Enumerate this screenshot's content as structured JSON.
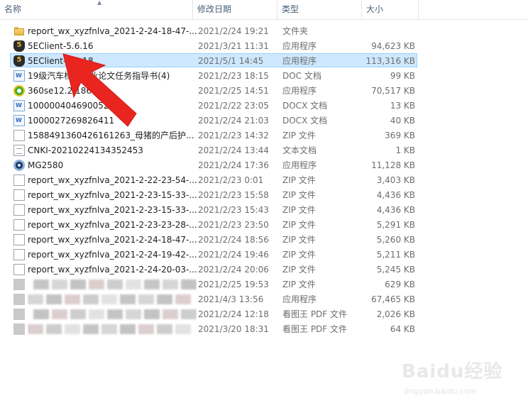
{
  "columns": {
    "name": "名称",
    "date": "修改日期",
    "type": "类型",
    "size": "大小"
  },
  "rows": [
    {
      "icon": "folder-icon",
      "name": "report_wx_xyzfnlva_2021-2-24-18-47-...",
      "date": "2021/2/24 19:21",
      "type": "文件夹",
      "size": ""
    },
    {
      "icon": "5eclient-app-icon",
      "name": "5EClient-5.6.16",
      "date": "2021/3/21 11:31",
      "type": "应用程序",
      "size": "94,623 KB"
    },
    {
      "icon": "5eclient-app-icon",
      "name": "5EClient-5.6.18",
      "date": "2021/5/1 14:45",
      "type": "应用程序",
      "size": "113,316 KB",
      "selected": true
    },
    {
      "icon": "word-doc-icon",
      "name": "19级汽车检测毕业论文任务指导书(4)",
      "date": "2021/2/23 18:15",
      "type": "DOC 文档",
      "size": "99 KB"
    },
    {
      "icon": "360-browser-icon",
      "name": "360se12.2.1860.0",
      "date": "2021/2/25 14:51",
      "type": "应用程序",
      "size": "70,517 KB"
    },
    {
      "icon": "word-doc-icon",
      "name": "1000004046900524",
      "date": "2021/2/22 23:05",
      "type": "DOCX 文档",
      "size": "13 KB"
    },
    {
      "icon": "word-doc-icon",
      "name": "1000027269826411",
      "date": "2021/2/24 21:03",
      "type": "DOCX 文档",
      "size": "40 KB"
    },
    {
      "icon": "zip-file-icon",
      "name": "1588491360426161263_母猪的产后护...",
      "date": "2021/2/23 14:32",
      "type": "ZIP 文件",
      "size": "369 KB"
    },
    {
      "icon": "text-file-icon",
      "name": "CNKI-20210224134352453",
      "date": "2021/2/24 13:44",
      "type": "文本文档",
      "size": "1 KB"
    },
    {
      "icon": "mg-app-icon",
      "name": "MG2580",
      "date": "2021/2/24 17:36",
      "type": "应用程序",
      "size": "11,128 KB"
    },
    {
      "icon": "zip-file-icon",
      "name": "report_wx_xyzfnlva_2021-2-22-23-54-...",
      "date": "2021/2/23 0:01",
      "type": "ZIP 文件",
      "size": "3,403 KB"
    },
    {
      "icon": "zip-file-icon",
      "name": "report_wx_xyzfnlva_2021-2-23-15-33-...",
      "date": "2021/2/23 15:58",
      "type": "ZIP 文件",
      "size": "4,436 KB"
    },
    {
      "icon": "zip-file-icon",
      "name": "report_wx_xyzfnlva_2021-2-23-15-33-...",
      "date": "2021/2/23 15:43",
      "type": "ZIP 文件",
      "size": "4,436 KB"
    },
    {
      "icon": "zip-file-icon",
      "name": "report_wx_xyzfnlva_2021-2-23-23-28-...",
      "date": "2021/2/23 23:50",
      "type": "ZIP 文件",
      "size": "5,291 KB"
    },
    {
      "icon": "zip-file-icon",
      "name": "report_wx_xyzfnlva_2021-2-24-18-47-...",
      "date": "2021/2/24 18:56",
      "type": "ZIP 文件",
      "size": "5,260 KB"
    },
    {
      "icon": "zip-file-icon",
      "name": "report_wx_xyzfnlva_2021-2-24-19-42-...",
      "date": "2021/2/24 19:46",
      "type": "ZIP 文件",
      "size": "5,211 KB"
    },
    {
      "icon": "zip-file-icon",
      "name": "report_wx_xyzfnlva_2021-2-24-20-03-...",
      "date": "2021/2/24 20:06",
      "type": "ZIP 文件",
      "size": "5,245 KB"
    },
    {
      "icon": "blurred-icon",
      "name": "",
      "date": "2021/2/25 19:53",
      "type": "ZIP 文件",
      "size": "629 KB",
      "blurred": true
    },
    {
      "icon": "blurred-icon",
      "name": "",
      "date": "2021/4/3 13:56",
      "type": "应用程序",
      "size": "67,465 KB",
      "blurred": true
    },
    {
      "icon": "blurred-icon",
      "name": "",
      "date": "2021/2/24 12:18",
      "type": "看图王 PDF 文件",
      "size": "2,026 KB",
      "blurred": true,
      "date_partial": "/2/24 12:18"
    },
    {
      "icon": "blurred-icon",
      "name": "",
      "date": "2021/3/20 18:31",
      "type": "看图王 PDF 文件",
      "size": "64 KB",
      "blurred": true,
      "date_partial": "3/20 18:31"
    }
  ],
  "watermark": {
    "logo": "Baidu经验",
    "url": "jingyan.baidu.com"
  },
  "colors": {
    "selected_bg": "#cde8ff",
    "selected_border": "#99d1ff",
    "arrow": "#e8251f",
    "header_text": "#4c607a"
  }
}
